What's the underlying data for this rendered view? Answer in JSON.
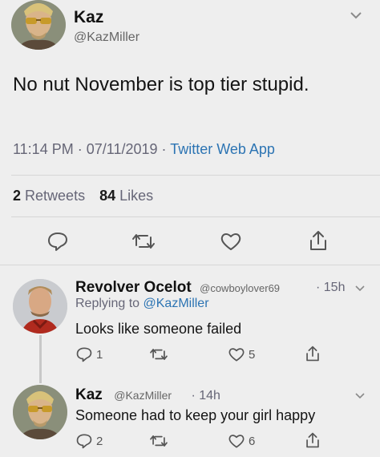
{
  "main_tweet": {
    "author_name": "Kaz",
    "author_handle": "@KazMiller",
    "text": "No nut November is top tier stupid.",
    "time": "11:14 PM",
    "sep1": "·",
    "date": "07/11/2019",
    "sep2": "·",
    "source": "Twitter Web App",
    "retweets_count": "2",
    "retweets_label": "Retweets",
    "likes_count": "84",
    "likes_label": "Likes"
  },
  "reply1": {
    "author_name": "Revolver Ocelot",
    "author_handle": "@cowboylover69",
    "time": "· 15h",
    "replying_prefix": "Replying to",
    "replying_handle": "@KazMiller",
    "text": "Looks like someone failed",
    "reply_count": "1",
    "retweet_count": "",
    "like_count": "5"
  },
  "reply2": {
    "author_name": "Kaz",
    "author_handle": "@KazMiller",
    "time": "· 14h",
    "text": "Someone had to keep your girl happy",
    "reply_count": "2",
    "retweet_count": "",
    "like_count": "6"
  },
  "icons": {
    "reply": "speech-bubble-icon",
    "retweet": "retweet-icon",
    "like": "heart-icon",
    "share": "share-icon",
    "more": "chevron-down-icon"
  },
  "colors": {
    "background": "#eeeeee",
    "link": "#2c74b3",
    "icon": "#555555"
  }
}
